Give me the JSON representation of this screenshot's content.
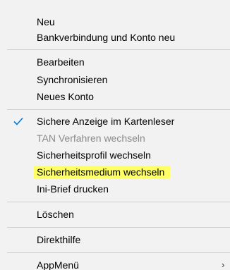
{
  "menu": {
    "items": [
      {
        "label": "Neu"
      },
      {
        "label": "Bankverbindung und Konto neu"
      },
      {
        "label": "Bearbeiten"
      },
      {
        "label": "Synchronisieren"
      },
      {
        "label": "Neues Konto"
      },
      {
        "label": "Sichere Anzeige im Kartenleser",
        "checked": true
      },
      {
        "label": "TAN Verfahren wechseln",
        "disabled": true
      },
      {
        "label": "Sicherheitsprofil wechseln"
      },
      {
        "label": "Sicherheitsmedium wechseln",
        "highlighted": true,
        "highlight_color": "#ffff66"
      },
      {
        "label": "Ini-Brief drucken"
      },
      {
        "label": "Löschen"
      },
      {
        "label": "Direkthilfe"
      },
      {
        "label": "AppMenü",
        "submenu_arrow": "›"
      }
    ]
  },
  "colors": {
    "menu_background": "#f2f2f2",
    "checkmark": "#0078d7",
    "disabled_text": "#8a8a8a",
    "highlight": "#ffff66"
  }
}
